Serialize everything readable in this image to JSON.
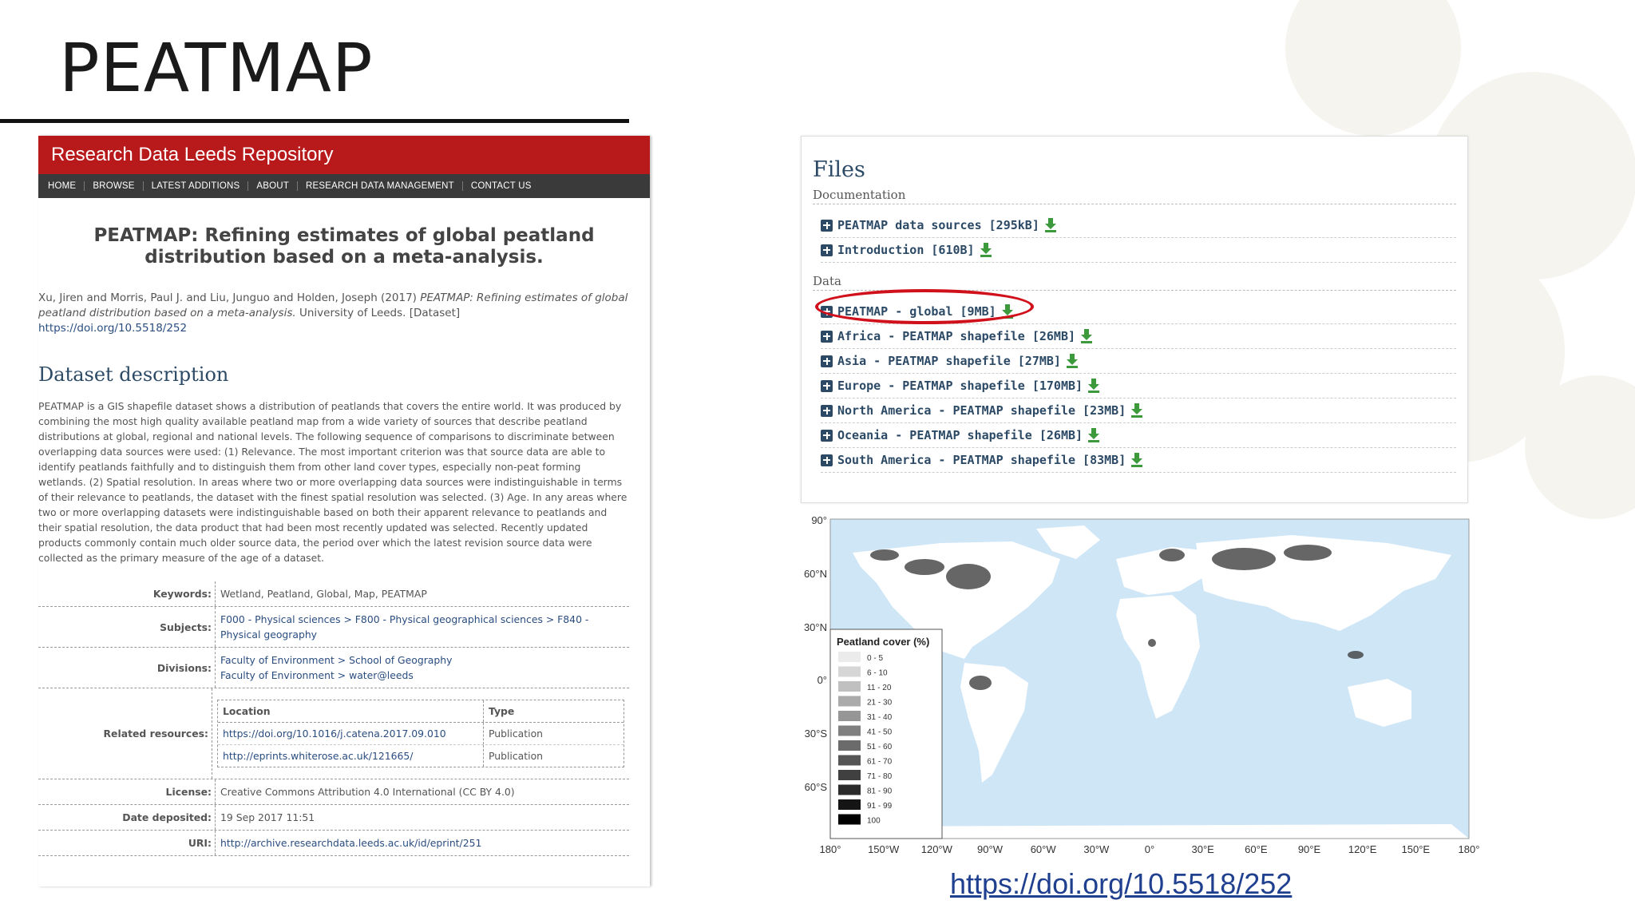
{
  "slide": {
    "title": "PEATMAP",
    "doi_link": "https://doi.org/10.5518/252"
  },
  "repo": {
    "header": "Research Data Leeds Repository",
    "nav": [
      "HOME",
      "BROWSE",
      "LATEST ADDITIONS",
      "ABOUT",
      "RESEARCH DATA MANAGEMENT",
      "CONTACT US"
    ],
    "title": "PEATMAP: Refining estimates of global peatland distribution based on a meta-analysis.",
    "citation": {
      "authors": "Xu, Jiren and Morris, Paul J. and Liu, Junguo and Holden, Joseph (2017) ",
      "title_italic": "PEATMAP: Refining estimates of global peatland distribution based on a meta-analysis.",
      "rest": " University of Leeds. [Dataset]",
      "doi": "https://doi.org/10.5518/252"
    },
    "section_heading": "Dataset description",
    "description": "PEATMAP is a GIS shapefile dataset shows a distribution of peatlands that covers the entire world. It was produced by combining the most high quality available peatland map from a wide variety of sources that describe peatland distributions at global, regional and national levels. The following sequence of comparisons to discriminate between overlapping data sources were used: (1) Relevance. The most important criterion was that source data are able to identify peatlands faithfully and to distinguish them from other land cover types, especially non-peat forming wetlands. (2) Spatial resolution. In areas where two or more overlapping data sources were indistinguishable in terms of their relevance to peatlands, the dataset with the finest spatial resolution was selected. (3) Age. In any areas where two or more overlapping datasets were indistinguishable based on both their apparent relevance to peatlands and their spatial resolution, the data product that had been most recently updated was selected. Recently updated products commonly contain much older source data, the period over which the latest revision source data were collected as the primary measure of the age of a dataset.",
    "meta": {
      "keywords_label": "Keywords:",
      "keywords": "Wetland, Peatland, Global, Map, PEATMAP",
      "subjects_label": "Subjects:",
      "subjects": "F000 - Physical sciences > F800 - Physical geographical sciences > F840 - Physical geography",
      "divisions_label": "Divisions:",
      "divisions_1": "Faculty of Environment > School of Geography",
      "divisions_2": "Faculty of Environment > water@leeds",
      "related_label": "Related resources:",
      "related_head_location": "Location",
      "related_head_type": "Type",
      "related": [
        {
          "location": "https://doi.org/10.1016/j.catena.2017.09.010",
          "type": "Publication"
        },
        {
          "location": "http://eprints.whiterose.ac.uk/121665/",
          "type": "Publication"
        }
      ],
      "license_label": "License:",
      "license": "Creative Commons Attribution 4.0 International (CC BY 4.0)",
      "date_label": "Date deposited:",
      "date": "19 Sep 2017 11:51",
      "uri_label": "URI:",
      "uri": "http://archive.researchdata.leeds.ac.uk/id/eprint/251"
    }
  },
  "files": {
    "heading": "Files",
    "documentation_heading": "Documentation",
    "documentation": [
      "PEATMAP data sources [295kB]",
      "Introduction [610B]"
    ],
    "data_heading": "Data",
    "data": [
      "PEATMAP - global [9MB]",
      "Africa - PEATMAP shapefile [26MB]",
      "Asia - PEATMAP shapefile [27MB]",
      "Europe - PEATMAP shapefile [170MB]",
      "North America - PEATMAP shapefile [23MB]",
      "Oceania - PEATMAP shapefile [26MB]",
      "South America - PEATMAP shapefile [83MB]"
    ]
  },
  "map": {
    "lat_labels": [
      "90°",
      "60°N",
      "30°N",
      "0°",
      "30°S",
      "60°S"
    ],
    "lon_labels": [
      "180°",
      "150°W",
      "120°W",
      "90°W",
      "60°W",
      "30°W",
      "0°",
      "30°E",
      "60°E",
      "90°E",
      "120°E",
      "150°E",
      "180°"
    ],
    "legend_title": "Peatland cover (%)",
    "legend": [
      "0 - 5",
      "6 - 10",
      "11 - 20",
      "21 - 30",
      "31 - 40",
      "41 - 50",
      "51 - 60",
      "61 - 70",
      "71 - 80",
      "81 - 90",
      "91 - 99",
      "100"
    ],
    "ocean_color": "#cfe6f7"
  }
}
